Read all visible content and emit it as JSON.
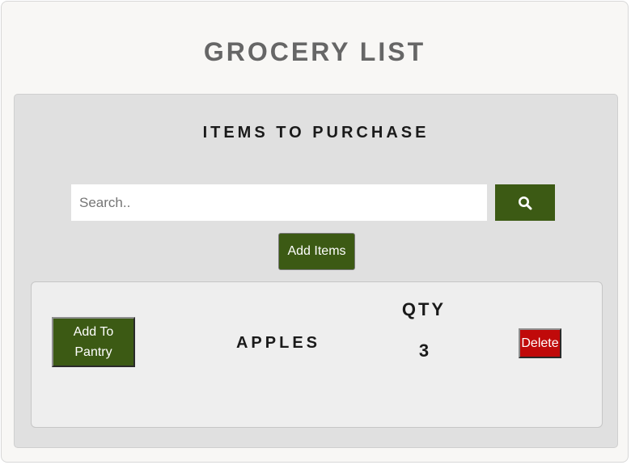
{
  "app": {
    "title": "GROCERY LIST"
  },
  "panel": {
    "title": "ITEMS TO PURCHASE"
  },
  "search": {
    "placeholder": "Search..",
    "value": "",
    "button_icon": "search-icon"
  },
  "actions": {
    "add_items_label": "Add Items"
  },
  "items": [
    {
      "pantry_button_label": "Add To Pantry",
      "name": "APPLES",
      "qty_label": "QTY",
      "qty_value": "3",
      "delete_label": "Delete"
    }
  ],
  "colors": {
    "primary_green": "#3c5a14",
    "delete_red": "#c00a0a",
    "title_gray": "#666666",
    "panel_bg": "#e0e0e0",
    "card_bg": "#eeeeee"
  }
}
